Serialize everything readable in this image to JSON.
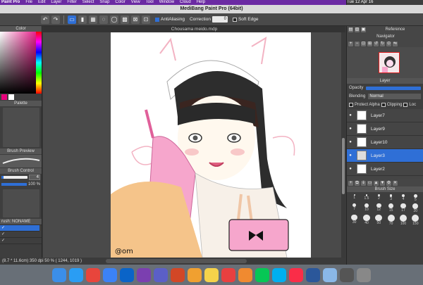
{
  "menubar": {
    "app": "Paint Pro",
    "items": [
      "File",
      "Edit",
      "Layer",
      "Filter",
      "Select",
      "Snap",
      "Color",
      "View",
      "Tool",
      "Window",
      "Cloud",
      "Help"
    ],
    "clock": "Tue 12 Apr 16"
  },
  "window": {
    "title": "MediBang Paint Pro (64bit)",
    "tab": "Chousama meido.mdp"
  },
  "toolbar": {
    "antialias_label": "AntiAliasing",
    "correction_label": "Correction",
    "correction_value": "0",
    "soft_edge_label": "Soft Edge"
  },
  "left": {
    "color_header": "Color",
    "palette_header": "Palette",
    "brush_preview_header": "Brush Preview",
    "brush_control_header": "Brush Control",
    "size_value": "4",
    "opacity_value": "100 %",
    "opacity_fraction": 1.0,
    "brush_name": "rush: NONAME"
  },
  "status": {
    "text": "(8.7 * 11.6cm)  350 dpi   50 %   ( 1244, 1019 )"
  },
  "right": {
    "reference_header": "Reference",
    "navigator_header": "Navigator",
    "layer_header": "Layer",
    "opacity_label": "Opacity",
    "blending_label": "Blending",
    "blending_value": "Normal",
    "protect_alpha": "Protect Alpha",
    "clipping": "Clipping",
    "lock": "Loc",
    "layers": [
      "Layer7",
      "Layer9",
      "Layer10",
      "Layer3",
      "Layer2"
    ],
    "selected_layer": "Layer3",
    "brush_size_header": "Brush Size",
    "brush_sizes": [
      "1",
      "1.5",
      "2",
      "3",
      "4",
      "5",
      "7",
      "10",
      "12",
      "15",
      "17",
      "20",
      "30",
      "40",
      "50",
      "70",
      "100",
      "150"
    ]
  },
  "dock": [
    "Finder",
    "Safari",
    "Chrome",
    "Mail",
    "Outlook",
    "OneNote",
    "Teams",
    "PowerPoint",
    "Photos",
    "Notes",
    "Calendar",
    "Reminders",
    "LINE",
    "Skype",
    "Music",
    "Word",
    "Preview",
    "Pen",
    "Trash"
  ],
  "colors": {
    "accent": "#2f6fd6",
    "menubar": "#6b2aa3"
  }
}
